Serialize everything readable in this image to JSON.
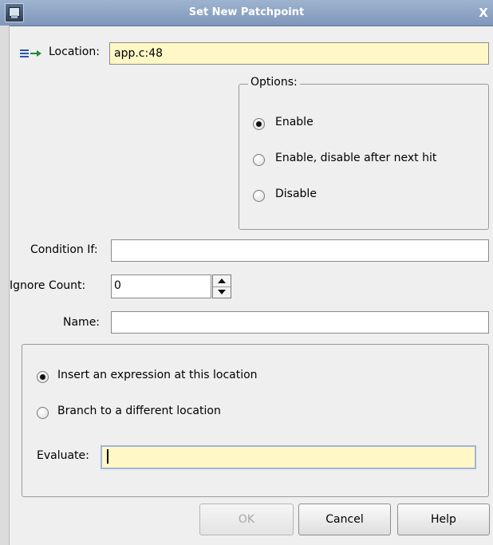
{
  "window": {
    "title": "Set New Patchpoint",
    "close_glyph": "X"
  },
  "location": {
    "label": "Location:",
    "value": "app.c:48",
    "icon": "arrow-location-icon"
  },
  "options": {
    "legend": "Options:",
    "items": [
      {
        "label": "Enable",
        "checked": true
      },
      {
        "label": "Enable, disable after next hit",
        "checked": false
      },
      {
        "label": "Disable",
        "checked": false
      }
    ]
  },
  "condition": {
    "label": "Condition If:",
    "value": ""
  },
  "ignore_count": {
    "label": "Ignore Count:",
    "value": "0"
  },
  "name": {
    "label": "Name:",
    "value": ""
  },
  "action": {
    "items": [
      {
        "label": "Insert an expression at this location",
        "checked": true
      },
      {
        "label": "Branch to a different location",
        "checked": false
      }
    ],
    "evaluate_label": "Evaluate:",
    "evaluate_value": ""
  },
  "buttons": {
    "ok": "OK",
    "cancel": "Cancel",
    "help": "Help"
  },
  "colors": {
    "highlight_field": "#fff8c6",
    "titlebar": "#8ea6c6"
  }
}
